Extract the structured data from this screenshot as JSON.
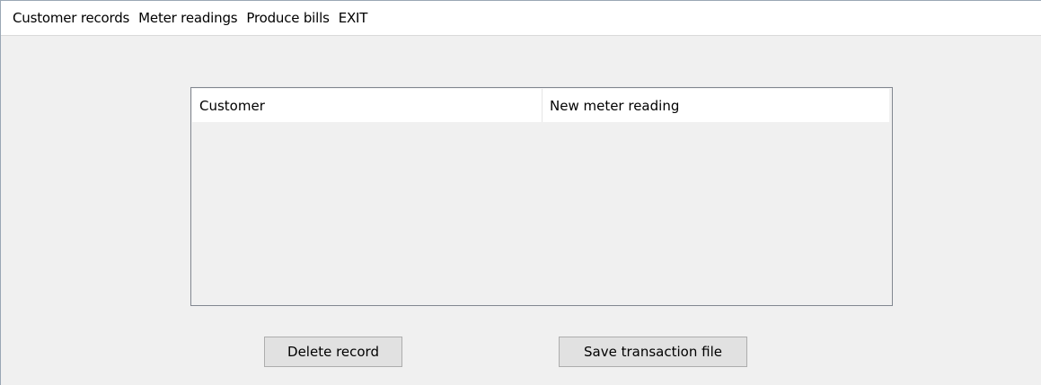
{
  "menubar": {
    "items": [
      {
        "label": "Customer records"
      },
      {
        "label": "Meter readings"
      },
      {
        "label": "Produce bills"
      },
      {
        "label": "EXIT"
      }
    ]
  },
  "table": {
    "columns": [
      {
        "label": "Customer"
      },
      {
        "label": "New meter reading"
      }
    ],
    "rows": []
  },
  "buttons": {
    "delete_label": "Delete record",
    "save_label": "Save transaction file"
  }
}
